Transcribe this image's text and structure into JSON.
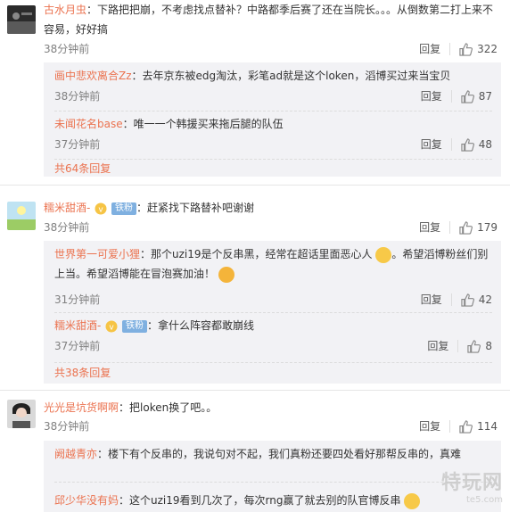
{
  "comments": [
    {
      "user": "古水月虫",
      "text": "下路把把崩，不考虑找点替补？中路都季后赛了还在当院长。。。从倒数第二打上来不容易，好好搞",
      "time": "38分钟前",
      "reply_label": "回复",
      "likes": "322",
      "replies": [
        {
          "user": "画中悲欢离合Zz",
          "text": "去年京东被edg淘汰，彩笔ad就是这个loken，滔博买过来当宝贝",
          "time": "38分钟前",
          "reply_label": "回复",
          "likes": "87"
        },
        {
          "user": "未闻花名base",
          "text": "唯一一个韩援买来拖后腿的队伍",
          "time": "37分钟前",
          "reply_label": "回复",
          "likes": "48"
        }
      ],
      "more": "共64条回复"
    },
    {
      "user": "糯米甜酒-",
      "badge": "铁粉",
      "text": "赶紧找下路替补吧谢谢",
      "time": "38分钟前",
      "reply_label": "回复",
      "likes": "179",
      "replies": [
        {
          "user": "世界第一可爱小狸",
          "text": "那个uzi19是个反串黑，经常在超话里面恶心人",
          "text2": "。希望滔博粉丝们别上当。希望滔博能在冒泡赛加油！",
          "time": "31分钟前",
          "reply_label": "回复",
          "likes": "42"
        },
        {
          "user": "糯米甜酒-",
          "badge": "铁粉",
          "text": "拿什么阵容都敢崩线",
          "time": "37分钟前",
          "reply_label": "回复",
          "likes": "8"
        }
      ],
      "more": "共38条回复"
    },
    {
      "user": "光光是坑货啊啊",
      "text": "把loken换了吧。。",
      "time": "38分钟前",
      "reply_label": "回复",
      "likes": "114",
      "replies": [
        {
          "user": "阙越青亦",
          "text": "楼下有个反串的，我说句对不起，我们真粉还要四处看好那帮反串的，真难"
        },
        {
          "user": "邱少华没有妈",
          "text": "这个uzi19看到几次了，每次rng赢了就去别的队官博反串"
        }
      ]
    }
  ],
  "watermark": {
    "main": "特玩网",
    "sub": "te5.com"
  }
}
